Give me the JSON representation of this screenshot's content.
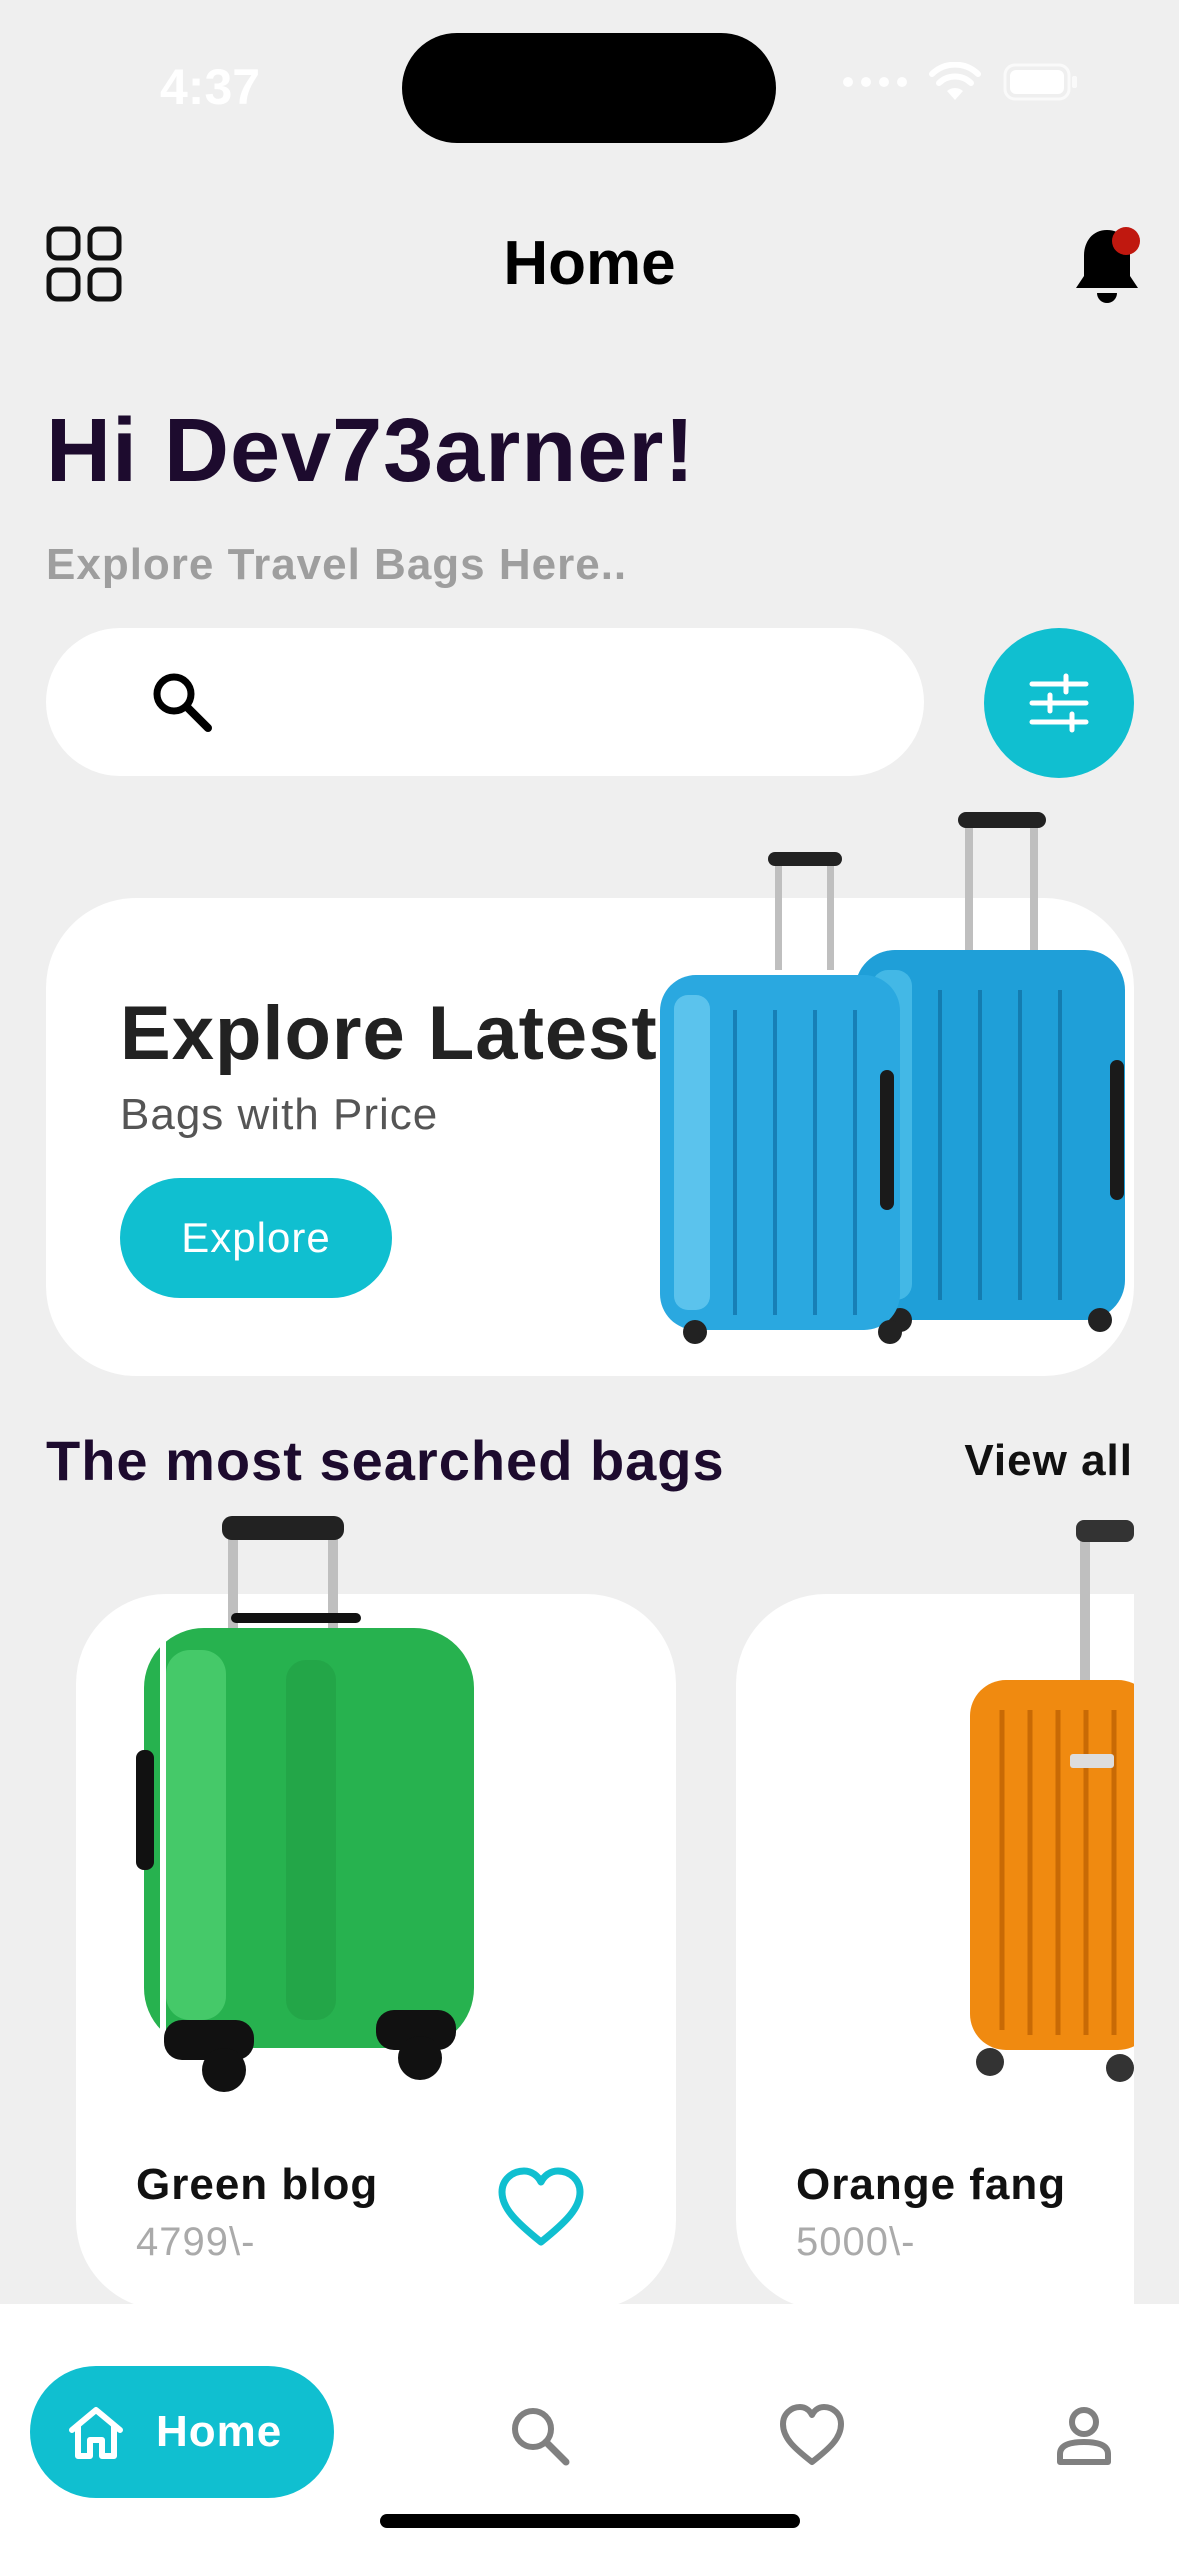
{
  "status_bar": {
    "time": "4:37"
  },
  "header": {
    "title": "Home"
  },
  "greeting": "Hi Dev73arner!",
  "subtitle": "Explore Travel Bags Here..",
  "search": {
    "placeholder": ""
  },
  "banner": {
    "title": "Explore Latest",
    "subtitle": "Bags with Price",
    "button_label": "Explore"
  },
  "section": {
    "title": "The most searched bags",
    "view_all_label": "View all"
  },
  "products": [
    {
      "name": "Green blog",
      "price": "4799\\-",
      "color": "#22b24c"
    },
    {
      "name": "Orange fang",
      "price": "5000\\-",
      "color": "#f08a10"
    }
  ],
  "bottom_nav": {
    "home_label": "Home",
    "items": [
      "home-icon",
      "search-icon",
      "heart-icon",
      "profile-icon"
    ]
  },
  "colors": {
    "accent": "#10bfd0",
    "background": "#efefef",
    "heading": "#1d0b2e",
    "notification_dot": "#c0180f"
  }
}
